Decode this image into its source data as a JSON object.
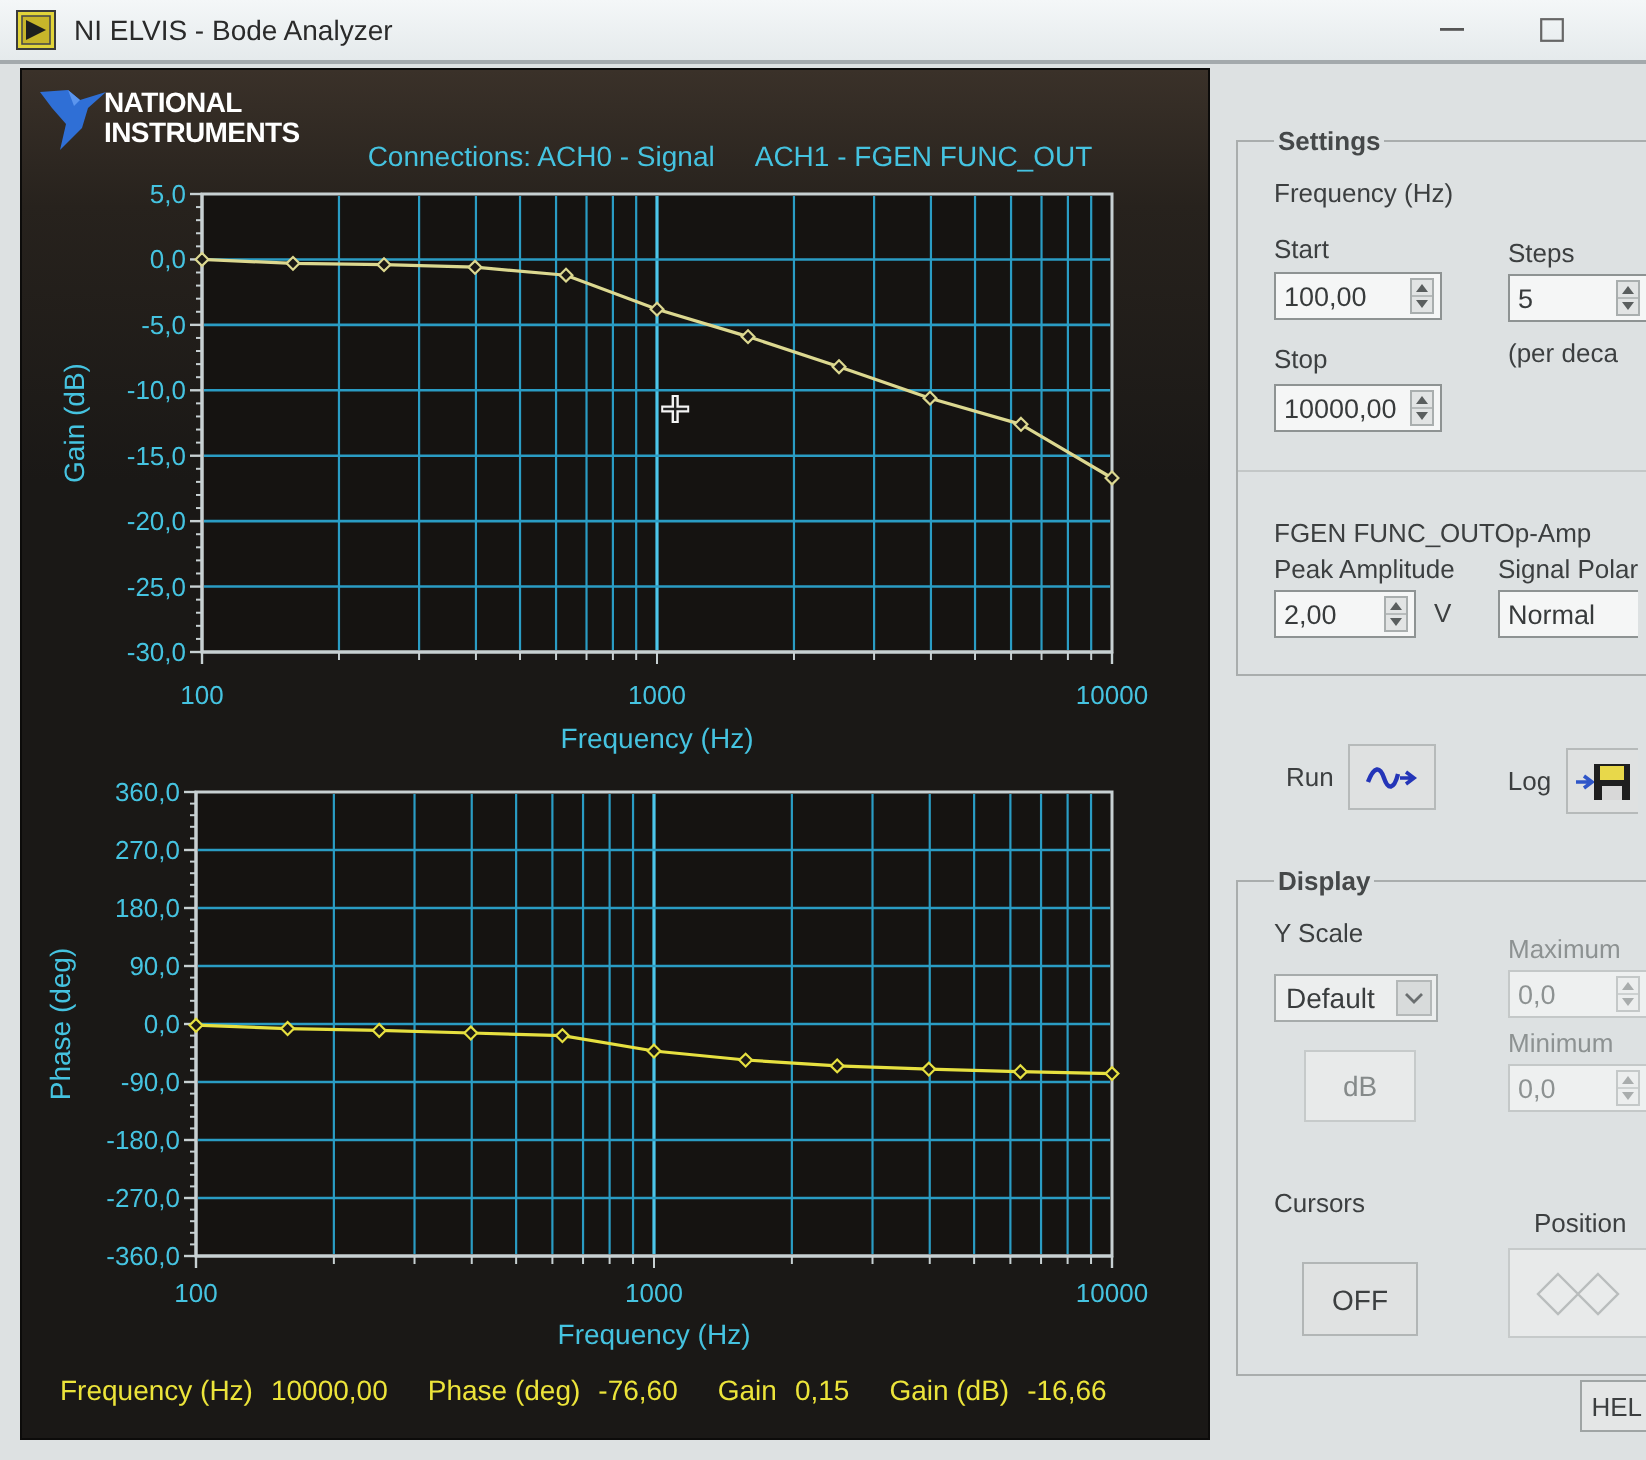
{
  "window": {
    "title": "NI ELVIS - Bode Analyzer"
  },
  "header": {
    "logo": [
      "NATIONAL",
      "INSTRUMENTS"
    ],
    "connections": [
      "Connections: ACH0 - Signal",
      "ACH1 - FGEN FUNC_OUT"
    ]
  },
  "gain_chart": {
    "chart_data": {
      "type": "line",
      "xlabel": "Frequency (Hz)",
      "ylabel": "Gain (dB)",
      "grid": true,
      "categories": [
        "100",
        null,
        null,
        null,
        null,
        "1000",
        null,
        null,
        null,
        null,
        "10000"
      ],
      "series": [
        {
          "color": "#dcd890",
          "marker": "diamond",
          "values": [
            0,
            -0.3,
            -0.4,
            -0.6,
            -1.2,
            -3.8,
            -5.9,
            -8.2,
            -10.6,
            -12.6,
            -16.7
          ]
        }
      ],
      "ylim": [
        -30,
        5
      ],
      "yticks": [
        {
          "value": 5,
          "label": "5,0"
        },
        {
          "value": 0,
          "label": "0,0"
        },
        {
          "value": -5,
          "label": "-5,0"
        },
        {
          "value": -10,
          "label": "-10,0"
        },
        {
          "value": -15,
          "label": "-15,0"
        },
        {
          "value": -20,
          "label": "-20,0"
        },
        {
          "value": -25,
          "label": "-25,0"
        },
        {
          "value": -30,
          "label": "-30,0"
        }
      ]
    }
  },
  "phase_chart": {
    "chart_data": {
      "type": "line",
      "xlabel": "Frequency (Hz)",
      "ylabel": "Phase (deg)",
      "grid": true,
      "categories": [
        "100",
        null,
        null,
        null,
        null,
        "1000",
        null,
        null,
        null,
        null,
        "10000"
      ],
      "series": [
        {
          "color": "#e6e040",
          "marker": "diamond",
          "values": [
            -2,
            -7,
            -10,
            -14,
            -18,
            -42,
            -56,
            -65,
            -70,
            -74,
            -77
          ]
        }
      ],
      "ylim": [
        -360,
        360
      ],
      "yticks": [
        {
          "value": 360,
          "label": "360,0"
        },
        {
          "value": 270,
          "label": "270,0"
        },
        {
          "value": 180,
          "label": "180,0"
        },
        {
          "value": 90,
          "label": "90,0"
        },
        {
          "value": 0,
          "label": "0,0"
        },
        {
          "value": -90,
          "label": "-90,0"
        },
        {
          "value": -180,
          "label": "-180,0"
        },
        {
          "value": -270,
          "label": "-270,0"
        },
        {
          "value": -360,
          "label": "-360,0"
        }
      ]
    }
  },
  "readout": [
    {
      "label": "Frequency (Hz)",
      "value": "10000,00"
    },
    {
      "label": "Phase (deg)",
      "value": "-76,60"
    },
    {
      "label": "Gain",
      "value": "0,15"
    },
    {
      "label": "Gain (dB)",
      "value": "-16,66"
    }
  ],
  "settings": {
    "title": "Settings",
    "frequency_label": "Frequency (Hz)",
    "start": {
      "label": "Start",
      "value": "100,00"
    },
    "stop": {
      "label": "Stop",
      "value": "10000,00"
    },
    "steps": {
      "label": "Steps",
      "value": "5",
      "note": "(per deca"
    },
    "fgen_title": "FGEN FUNC_OUTOp-Amp",
    "peak_amplitude": {
      "label": "Peak Amplitude",
      "value": "2,00",
      "unit": "V"
    },
    "signal_polarity": {
      "label": "Signal Polar",
      "value": "Normal"
    }
  },
  "actions": [
    {
      "kind": "run",
      "label": "Run"
    },
    {
      "kind": "log",
      "label": "Log"
    }
  ],
  "display": {
    "title": "Display",
    "y_scale": {
      "label": "Y Scale",
      "value": "Default"
    },
    "db_button": {
      "label": "dB",
      "disabled": true
    },
    "maximum": {
      "label": "Maximum",
      "value": "0,0",
      "disabled": true
    },
    "minimum": {
      "label": "Minimum",
      "value": "0,0",
      "disabled": true
    },
    "cursors": {
      "label": "Cursors",
      "button": "OFF",
      "disabled": false
    },
    "position": {
      "label": "Position",
      "disabled": true
    }
  },
  "help_button": "HEL"
}
